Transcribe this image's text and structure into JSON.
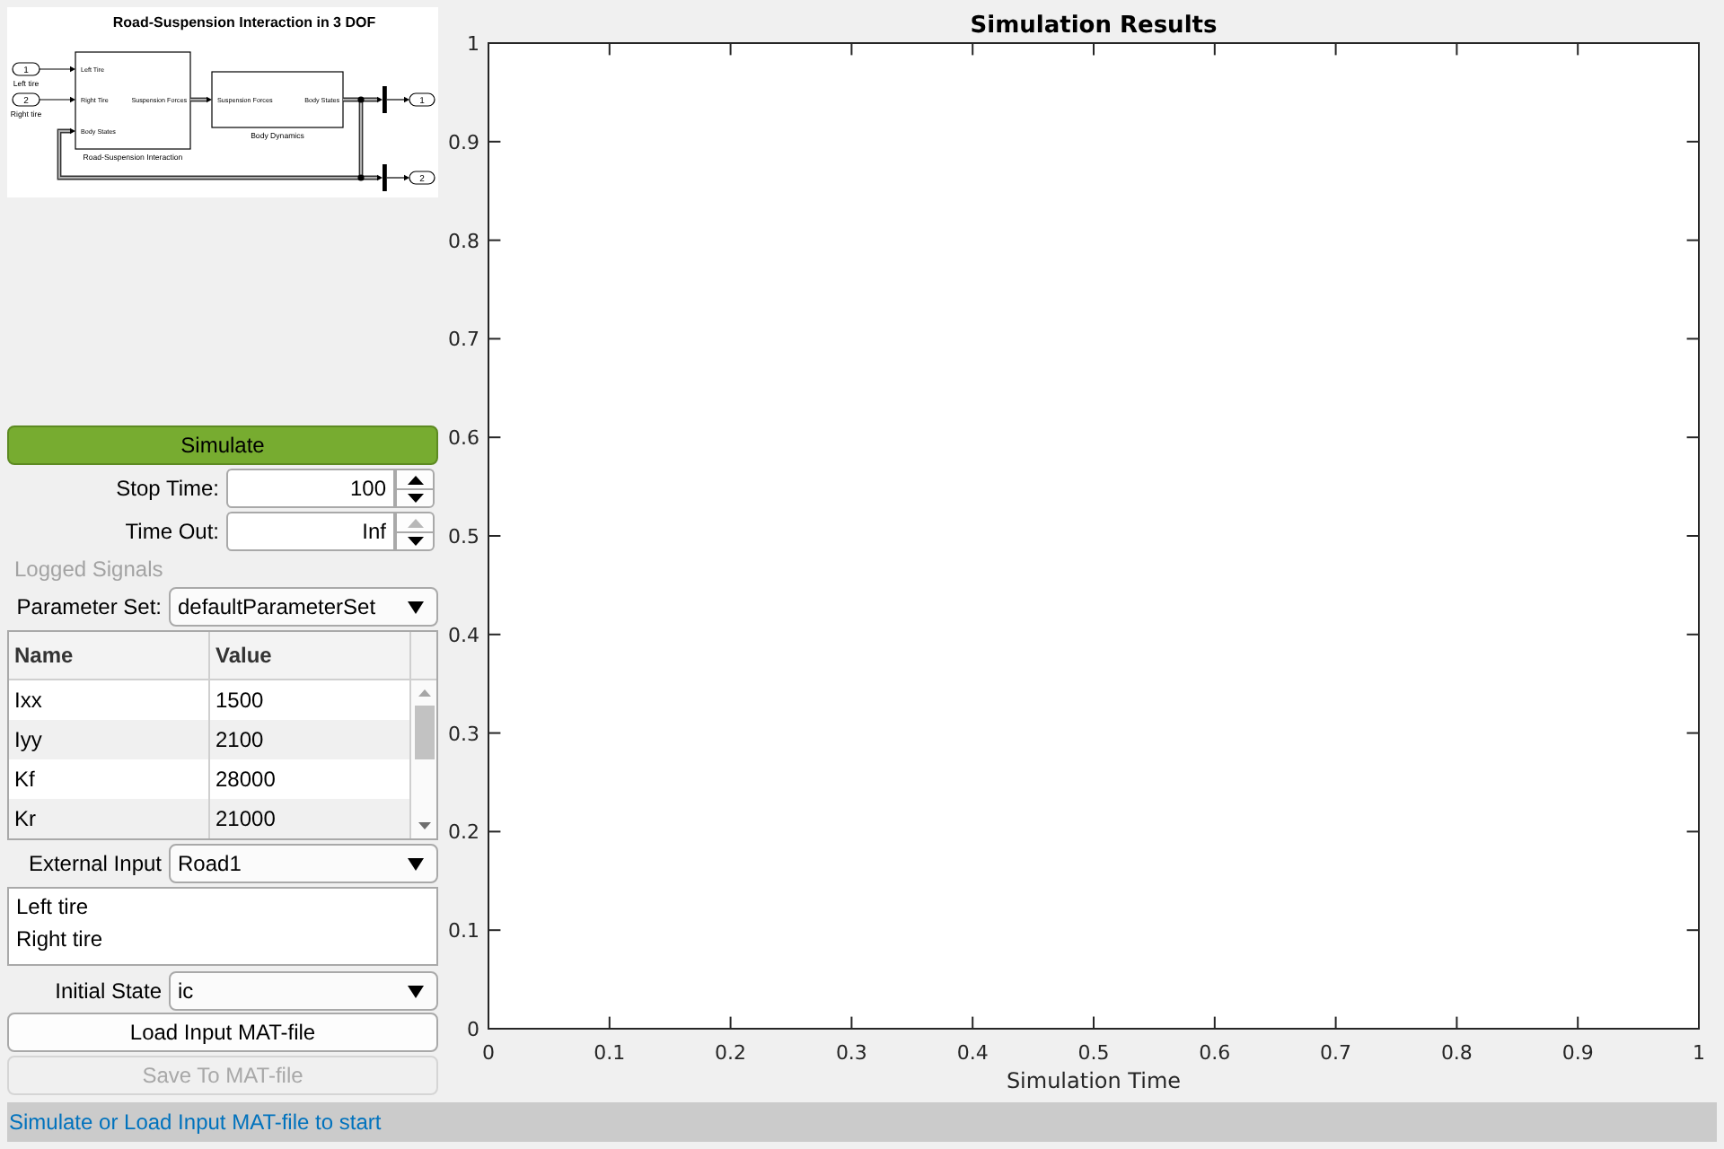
{
  "model_diagram": {
    "title": "Road-Suspension Interaction in 3 DOF",
    "inports": [
      {
        "number": "1",
        "label": "Left tire"
      },
      {
        "number": "2",
        "label": "Right tire"
      }
    ],
    "blocks": [
      {
        "name": "Road-Suspension Interaction",
        "inputs": [
          "Left Tire",
          "Right Tire",
          "Body States"
        ],
        "outputs": [
          "Suspension Forces"
        ]
      },
      {
        "name": "Body Dynamics",
        "inputs": [
          "Suspension Forces"
        ],
        "outputs": [
          "Body States"
        ]
      }
    ],
    "outports": [
      {
        "number": "1"
      },
      {
        "number": "2"
      }
    ]
  },
  "simulate_button": {
    "label": "Simulate"
  },
  "stop_time": {
    "label": "Stop Time:",
    "value": "100",
    "up_disabled": false,
    "down_disabled": false
  },
  "time_out": {
    "label": "Time Out:",
    "value": "Inf",
    "up_disabled": true,
    "down_disabled": false
  },
  "logged_signals": {
    "label": "Logged Signals",
    "disabled": true
  },
  "parameter_set": {
    "label": "Parameter Set:",
    "value": "defaultParameterSet"
  },
  "parameter_table": {
    "columns": [
      "Name",
      "Value"
    ],
    "rows": [
      [
        "Ixx",
        "1500"
      ],
      [
        "Iyy",
        "2100"
      ],
      [
        "Kf",
        "28000"
      ],
      [
        "Kr",
        "21000"
      ]
    ]
  },
  "external_input": {
    "label": "External Input",
    "value": "Road1"
  },
  "input_signals": {
    "items": [
      "Left tire",
      "Right tire"
    ]
  },
  "initial_state": {
    "label": "Initial State",
    "value": "ic"
  },
  "load_button": {
    "label": "Load Input MAT-file",
    "disabled": false
  },
  "save_button": {
    "label": "Save To MAT-file",
    "disabled": true
  },
  "results_plot": {
    "chart_data": {
      "type": "line",
      "title": "Simulation Results",
      "xlabel": "Simulation Time",
      "xlim": [
        0,
        1
      ],
      "ylim": [
        0,
        1
      ],
      "xticks": [
        0,
        0.1,
        0.2,
        0.3,
        0.4,
        0.5,
        0.6,
        0.7,
        0.8,
        0.9,
        1
      ],
      "yticks": [
        0,
        0.1,
        0.2,
        0.3,
        0.4,
        0.5,
        0.6,
        0.7,
        0.8,
        0.9,
        1
      ]
    }
  },
  "status_bar": {
    "text": "Simulate or Load Input MAT-file to start"
  }
}
